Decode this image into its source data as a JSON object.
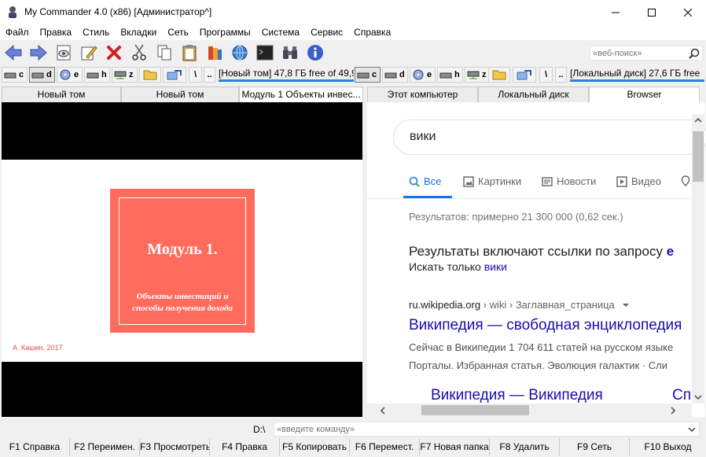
{
  "window": {
    "title": "My Commander 4.0 (x86) [Администратор^]",
    "minimize_icon": "minimize-icon",
    "maximize_icon": "maximize-icon",
    "close_icon": "close-icon"
  },
  "menu": [
    "Файл",
    "Правка",
    "Стиль",
    "Вкладки",
    "Сеть",
    "Программы",
    "Система",
    "Сервис",
    "Справка"
  ],
  "websearch": {
    "placeholder": "«веб-поиск»"
  },
  "left_panel": {
    "drives": [
      "c",
      "d",
      "e",
      "h",
      "z"
    ],
    "active_drive": "d",
    "root": "\\",
    "up": "..",
    "drive_info": "[Новый том] 47,8 ГБ free of 49,9",
    "tabs": [
      "Новый том",
      "Новый том",
      "Модуль 1 Объекты инвес..."
    ],
    "slide": {
      "title": "Модуль 1.",
      "subtitle_line1": "Объекты инвестиций и",
      "subtitle_line2": "способы получения дохода",
      "author": "А. Кашин. 2017"
    }
  },
  "right_panel": {
    "drives": [
      "c",
      "d",
      "e",
      "h",
      "z"
    ],
    "active_drive": "c",
    "root": "\\",
    "up": "..",
    "drive_info": "[Локальный диск] 27,6 ГБ free",
    "tabs": [
      "Этот компьютер",
      "Локальный диск",
      "Browser"
    ],
    "browser": {
      "query": "вики",
      "tabs": [
        "Все",
        "Картинки",
        "Новости",
        "Видео"
      ],
      "result_count": "Результатов: примерно 21 300 000 (0,62 сек.)",
      "includes_text": "Результаты включают ссылки по запросу",
      "includes_bold": "е",
      "search_only_prefix": "Искать только",
      "search_only_link": "вики",
      "cite_domain": "ru.wikipedia.org",
      "cite_path": " › wiki › Заглавная_страница",
      "result_title": "Википедия — свободная энциклопедия",
      "desc1": "Сейчас в Википедии 1 704 611 статей на русском языке",
      "desc2": "Порталы. Избранная статья. Эволюция галактик · Сли",
      "sub1": "Википедия — Википедия",
      "sub2": "Сп"
    }
  },
  "command": {
    "path": "D:\\",
    "placeholder": "«введите команду»"
  },
  "fkeys": [
    "F1 Справка",
    "F2 Переимен.",
    "F3 Просмотреть",
    "F4 Правка",
    "F5 Копировать",
    "F6 Перемест.",
    "F7 Новая папка",
    "F8 Удалить",
    "F9 Сеть",
    "F10 Выход"
  ]
}
